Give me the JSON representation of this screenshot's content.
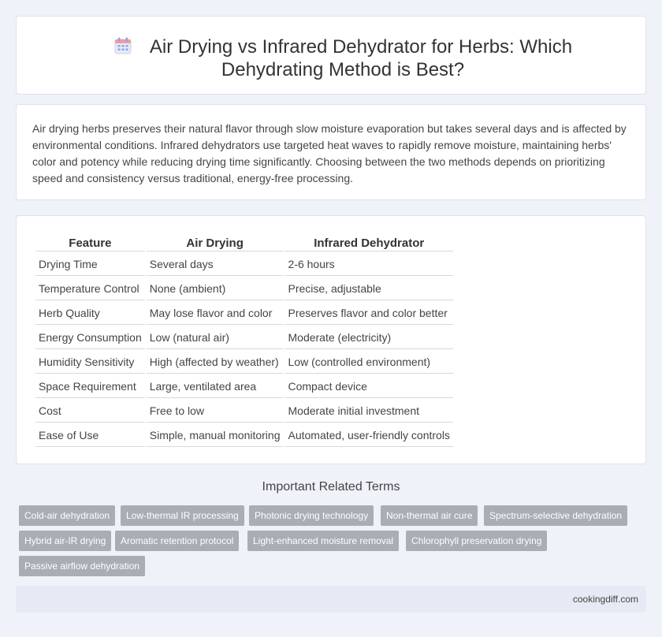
{
  "header": {
    "title": "Air Drying vs Infrared Dehydrator for Herbs: Which Dehydrating Method is Best?",
    "icon": "calendar-icon"
  },
  "intro": {
    "text": "Air drying herbs preserves their natural flavor through slow moisture evaporation but takes several days and is affected by environmental conditions. Infrared dehydrators use targeted heat waves to rapidly remove moisture, maintaining herbs' color and potency while reducing drying time significantly. Choosing between the two methods depends on prioritizing speed and consistency versus traditional, energy-free processing."
  },
  "table": {
    "headers": [
      "Feature",
      "Air Drying",
      "Infrared Dehydrator"
    ],
    "rows": [
      [
        "Drying Time",
        "Several days",
        "2-6 hours"
      ],
      [
        "Temperature Control",
        "None (ambient)",
        "Precise, adjustable"
      ],
      [
        "Herb Quality",
        "May lose flavor and color",
        "Preserves flavor and color better"
      ],
      [
        "Energy Consumption",
        "Low (natural air)",
        "Moderate (electricity)"
      ],
      [
        "Humidity Sensitivity",
        "High (affected by weather)",
        "Low (controlled environment)"
      ],
      [
        "Space Requirement",
        "Large, ventilated area",
        "Compact device"
      ],
      [
        "Cost",
        "Free to low",
        "Moderate initial investment"
      ],
      [
        "Ease of Use",
        "Simple, manual monitoring",
        "Automated, user-friendly controls"
      ]
    ]
  },
  "related": {
    "title": "Important Related Terms",
    "tags": [
      "Cold-air dehydration",
      "Low-thermal IR processing",
      "Photonic drying technology",
      "Non-thermal air cure",
      "Spectrum-selective dehydration",
      "Hybrid air-IR drying",
      "Aromatic retention protocol",
      "Light-enhanced moisture removal",
      "Chlorophyll preservation drying",
      "Passive airflow dehydration"
    ]
  },
  "footer": {
    "site": "cookingdiff.com"
  },
  "colors": {
    "tag_bg": "#a9adb4",
    "page_bg": "#eff2f8",
    "footer_bg": "#e6eaf4",
    "icon_accent": "#8aa4e8"
  }
}
